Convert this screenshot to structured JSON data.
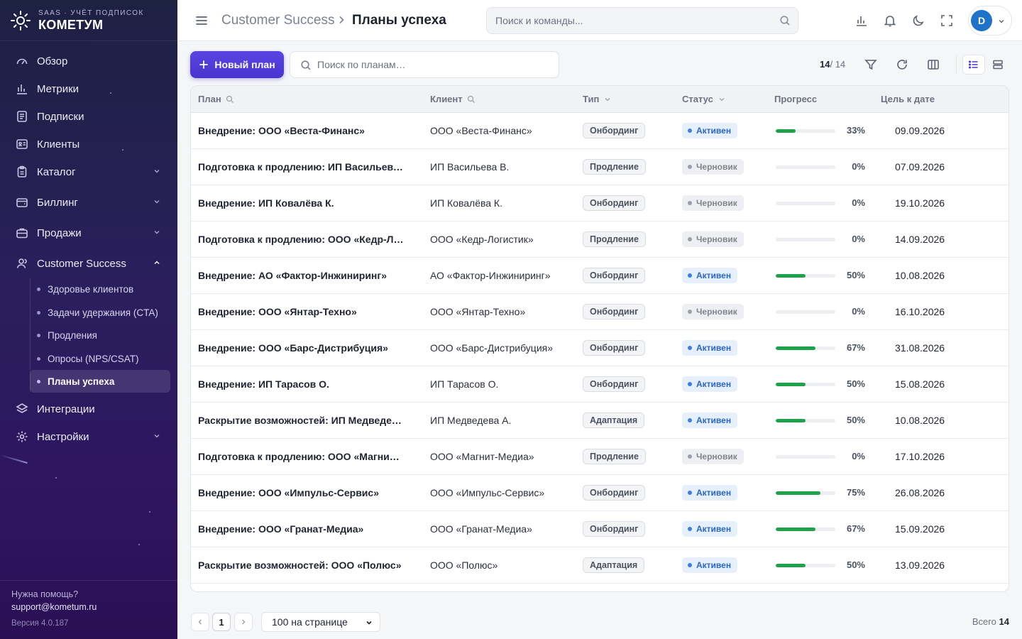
{
  "brand": {
    "subtitle": "SAAS · УЧЁТ ПОДПИСОК",
    "name": "КОМЕТУМ",
    "icon": "sun-logo-icon"
  },
  "sidebar": {
    "items": [
      {
        "label": "Обзор",
        "icon": "gauge-icon"
      },
      {
        "label": "Метрики",
        "icon": "bar-chart-icon"
      },
      {
        "label": "Подписки",
        "icon": "document-icon"
      },
      {
        "label": "Клиенты",
        "icon": "id-card-icon"
      },
      {
        "label": "Каталог",
        "icon": "clipboard-icon",
        "expandable": true
      },
      {
        "label": "Биллинг",
        "icon": "wallet-icon",
        "expandable": true
      },
      {
        "label": "Продажи",
        "icon": "briefcase-icon",
        "expandable": true
      },
      {
        "label": "Customer Success",
        "icon": "user-icon",
        "expanded": true
      },
      {
        "label": "Интеграции",
        "icon": "layers-icon"
      },
      {
        "label": "Настройки",
        "icon": "gear-icon",
        "expandable": true
      }
    ],
    "cs_subitems": [
      {
        "label": "Здоровье клиентов"
      },
      {
        "label": "Задачи удержания (CTA)"
      },
      {
        "label": "Продления"
      },
      {
        "label": "Опросы (NPS/CSAT)"
      },
      {
        "label": "Планы успеха",
        "active": true
      }
    ],
    "help_text": "Нужна помощь?",
    "help_email": "support@kometum.ru",
    "version": "Версия 4.0.187"
  },
  "topbar": {
    "breadcrumb_parent": "Customer Success",
    "breadcrumb_current": "Планы успеха",
    "search_placeholder": "Поиск и команды...",
    "avatar_initial": "D"
  },
  "toolbar": {
    "new_button": "Новый план",
    "search_placeholder": "Поиск по планам…",
    "count_shown": "14",
    "count_total": "/ 14"
  },
  "table": {
    "columns": [
      "План",
      "Клиент",
      "Тип",
      "Статус",
      "Прогресс",
      "Цель к дате"
    ],
    "rows": [
      {
        "plan": "Внедрение: ООО «Веста-Финанс»",
        "client": "ООО «Веста-Финанс»",
        "type": "Онбординг",
        "status": "Активен",
        "status_kind": "active",
        "progress": 33,
        "progress_label": "33%",
        "date": "09.09.2026"
      },
      {
        "plan": "Подготовка к продлению: ИП Васильева В.",
        "client": "ИП Васильева В.",
        "type": "Продление",
        "status": "Черновик",
        "status_kind": "draft",
        "progress": 0,
        "progress_label": "0%",
        "date": "07.09.2026"
      },
      {
        "plan": "Внедрение: ИП Ковалёва К.",
        "client": "ИП Ковалёва К.",
        "type": "Онбординг",
        "status": "Черновик",
        "status_kind": "draft",
        "progress": 0,
        "progress_label": "0%",
        "date": "19.10.2026"
      },
      {
        "plan": "Подготовка к продлению: ООО «Кедр-Логистик»",
        "client": "ООО «Кедр-Логистик»",
        "type": "Продление",
        "status": "Черновик",
        "status_kind": "draft",
        "progress": 0,
        "progress_label": "0%",
        "date": "14.09.2026"
      },
      {
        "plan": "Внедрение: АО «Фактор-Инжиниринг»",
        "client": "АО «Фактор-Инжиниринг»",
        "type": "Онбординг",
        "status": "Активен",
        "status_kind": "active",
        "progress": 50,
        "progress_label": "50%",
        "date": "10.08.2026"
      },
      {
        "plan": "Внедрение: ООО «Янтар-Техно»",
        "client": "ООО «Янтар-Техно»",
        "type": "Онбординг",
        "status": "Черновик",
        "status_kind": "draft",
        "progress": 0,
        "progress_label": "0%",
        "date": "16.10.2026"
      },
      {
        "plan": "Внедрение: ООО «Барс-Дистрибуция»",
        "client": "ООО «Барс-Дистрибуция»",
        "type": "Онбординг",
        "status": "Активен",
        "status_kind": "active",
        "progress": 67,
        "progress_label": "67%",
        "date": "31.08.2026"
      },
      {
        "plan": "Внедрение: ИП Тарасов О.",
        "client": "ИП Тарасов О.",
        "type": "Онбординг",
        "status": "Активен",
        "status_kind": "active",
        "progress": 50,
        "progress_label": "50%",
        "date": "15.08.2026"
      },
      {
        "plan": "Раскрытие возможностей: ИП Медведева А.",
        "client": "ИП Медведева А.",
        "type": "Адаптация",
        "status": "Активен",
        "status_kind": "active",
        "progress": 50,
        "progress_label": "50%",
        "date": "10.08.2026"
      },
      {
        "plan": "Подготовка к продлению: ООО «Магнит-Медиа»",
        "client": "ООО «Магнит-Медиа»",
        "type": "Продление",
        "status": "Черновик",
        "status_kind": "draft",
        "progress": 0,
        "progress_label": "0%",
        "date": "17.10.2026"
      },
      {
        "plan": "Внедрение: ООО «Импульс-Сервис»",
        "client": "ООО «Импульс-Сервис»",
        "type": "Онбординг",
        "status": "Активен",
        "status_kind": "active",
        "progress": 75,
        "progress_label": "75%",
        "date": "26.08.2026"
      },
      {
        "plan": "Внедрение: ООО «Гранат-Медиа»",
        "client": "ООО «Гранат-Медиа»",
        "type": "Онбординг",
        "status": "Активен",
        "status_kind": "active",
        "progress": 67,
        "progress_label": "67%",
        "date": "15.09.2026"
      },
      {
        "plan": "Раскрытие возможностей: ООО «Полюс»",
        "client": "ООО «Полюс»",
        "type": "Адаптация",
        "status": "Активен",
        "status_kind": "active",
        "progress": 50,
        "progress_label": "50%",
        "date": "13.09.2026"
      }
    ]
  },
  "pagination": {
    "current_page": "1",
    "per_page": "100 на странице",
    "total_label": "Всего",
    "total_value": "14"
  },
  "colors": {
    "accent": "#4a34d0",
    "progress": "#1fa34a",
    "active_status": "#2a66c8",
    "draft_status": "#80868f"
  }
}
